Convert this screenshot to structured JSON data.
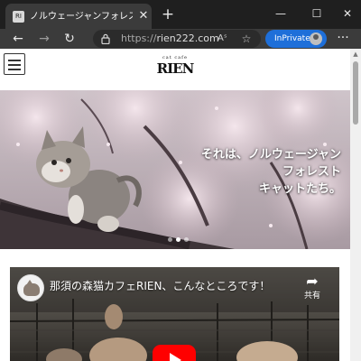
{
  "browser": {
    "tab": {
      "favicon_text": "RI",
      "title": "ノルウェージャンフォレストキャット専門",
      "close_glyph": "✕"
    },
    "new_tab_glyph": "+",
    "window_controls": {
      "minimize": "—",
      "maximize": "☐",
      "close": "✕"
    },
    "nav": {
      "back": "←",
      "forward": "→",
      "refresh": "↻",
      "home": "⌂"
    },
    "address": {
      "scheme": "https://",
      "host": "rien222.com"
    },
    "read_aloud_glyph": "Aˢ",
    "favorite_glyph": "☆",
    "inprivate_label": "InPrivate",
    "more_glyph": "···",
    "icons": [
      "lock-icon",
      "read-aloud-icon",
      "add-favorite-icon",
      "profile-icon"
    ]
  },
  "site": {
    "logo_small": "cat cafe",
    "logo_main": "RIEN",
    "hero": {
      "caption_lines": [
        "それは、ノルウェージャン",
        "フォレスト",
        "キャットたち。"
      ],
      "slides_total": 3,
      "active_slide": 1
    },
    "video": {
      "title": "那須の森猫カフェRIEN、こんなところです！",
      "share_label": "共有",
      "share_glyph": "➦"
    }
  },
  "colors": {
    "tab_bar": "#1f1f1f",
    "toolbar": "#3b3b3b",
    "inprivate": "#1e6fd9",
    "youtube_red": "#ff0000"
  }
}
